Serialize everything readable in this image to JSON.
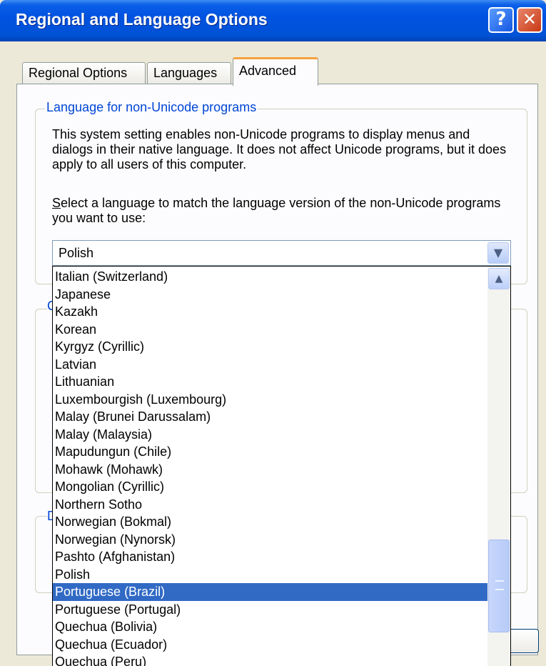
{
  "window": {
    "title": "Regional and Language Options",
    "help_label": "?",
    "close_label": "✕"
  },
  "tabs": [
    {
      "label": "Regional Options",
      "active": false
    },
    {
      "label": "Languages",
      "active": false
    },
    {
      "label": "Advanced",
      "active": true
    }
  ],
  "section": {
    "title": "Language for non-Unicode programs",
    "description": "This system setting enables non-Unicode programs to display menus and dialogs in their native language. It does not affect Unicode programs, but it does apply to all users of this computer.",
    "prompt_access_key": "S",
    "prompt_rest": "elect a language to match the language version of the non-Unicode programs you want to use:",
    "hidden_group_letter_1": "C",
    "hidden_group_letter_2": "D"
  },
  "combo": {
    "value": "Polish",
    "arrow_icon": "chevron-down-icon"
  },
  "dropdown": {
    "items": [
      "Italian (Switzerland)",
      "Japanese",
      "Kazakh",
      "Korean",
      "Kyrgyz (Cyrillic)",
      "Latvian",
      "Lithuanian",
      "Luxembourgish (Luxembourg)",
      "Malay (Brunei Darussalam)",
      "Malay (Malaysia)",
      "Mapudungun (Chile)",
      "Mohawk (Mohawk)",
      "Mongolian (Cyrillic)",
      "Northern Sotho",
      "Norwegian (Bokmal)",
      "Norwegian (Nynorsk)",
      "Pashto (Afghanistan)",
      "Polish",
      "Portuguese (Brazil)",
      "Portuguese (Portugal)",
      "Quechua (Bolivia)",
      "Quechua (Ecuador)",
      "Quechua (Peru)"
    ],
    "selected_index": 18
  },
  "colors": {
    "titlebar": "#0053e1",
    "selection": "#316ac5",
    "group_title": "#0046d5",
    "active_tab_accent": "#f7a23e"
  }
}
